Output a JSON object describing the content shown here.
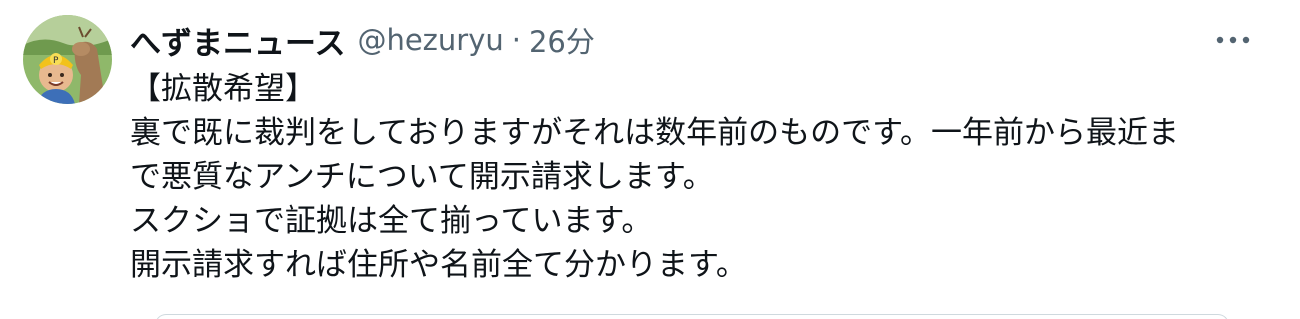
{
  "tweet": {
    "author": {
      "display_name": "へずまニュース",
      "handle": "@hezuryu",
      "separator": "·",
      "time": "26分",
      "avatar_icon": "user-avatar-photo"
    },
    "more_icon": "more-horizontal-icon",
    "text_lines": [
      "【拡散希望】",
      "裏で既に裁判をしておりますがそれは数年前のものです。一年前から最近ま",
      "で悪質なアンチについて開示請求します。",
      "スクショで証拠は全て揃っています。",
      "開示請求すれば住所や名前全て分かります。"
    ]
  },
  "colors": {
    "text_primary": "#0f1419",
    "text_secondary": "#536471",
    "border": "#cfd9de",
    "background": "#ffffff"
  }
}
